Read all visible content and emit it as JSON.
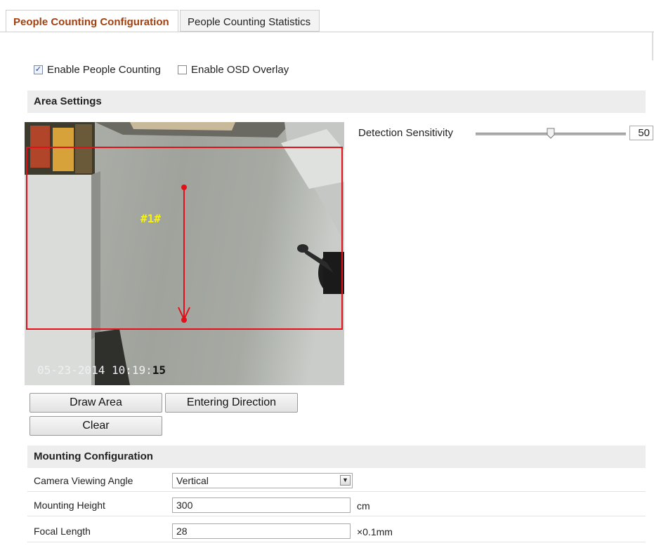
{
  "tabs": [
    {
      "label": "People Counting Configuration",
      "active": true
    },
    {
      "label": "People Counting Statistics",
      "active": false
    }
  ],
  "options": {
    "enable_people_counting": {
      "label": "Enable People Counting",
      "checked": true
    },
    "enable_osd_overlay": {
      "label": "Enable OSD Overlay",
      "checked": false
    }
  },
  "area_settings": {
    "title": "Area Settings",
    "video": {
      "timestamp_main": "05-23-2014 10:19:",
      "timestamp_seconds": "15",
      "area_label": "#1#"
    },
    "detection_sensitivity": {
      "label": "Detection Sensitivity",
      "value": "50",
      "level": 50
    },
    "buttons": {
      "draw_area": "Draw Area",
      "entering_direction": "Entering Direction",
      "clear": "Clear"
    }
  },
  "mounting": {
    "title": "Mounting Configuration",
    "camera_viewing_angle": {
      "label": "Camera Viewing Angle",
      "value": "Vertical"
    },
    "mounting_height": {
      "label": "Mounting Height",
      "value": "300",
      "unit": "cm"
    },
    "focal_length": {
      "label": "Focal Length",
      "value": "28",
      "unit": "×0.1mm"
    }
  },
  "colors": {
    "active_tab_text": "#a34010",
    "section_bg": "#ededed",
    "area_border": "#e3101a",
    "area_label": "#f7f20c"
  },
  "icons": {
    "checkbox_checked": "checkmark-icon",
    "select_arrow": "chevron-down-icon",
    "slider_thumb": "slider-thumb-icon"
  }
}
